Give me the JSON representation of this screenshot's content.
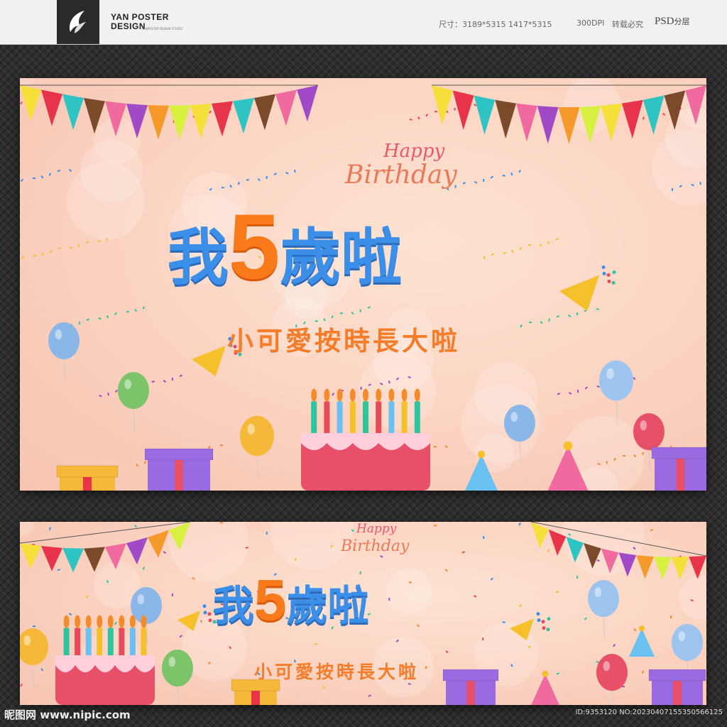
{
  "header": {
    "brand_line1": "YAN POSTER",
    "brand_line2": "DESIGN",
    "brand_sub": "YANPOSTER DESIGN STUDIO",
    "size_label": "尺寸：3189*5315  1417*5315",
    "dpi": "300DPI",
    "copyright": "转载必究",
    "psd": "PSD",
    "layers": "分层"
  },
  "poster": {
    "happy": "Happy",
    "birthday": "Birthday",
    "title_char1": "我",
    "title_number": "5",
    "title_rest": "歲啦",
    "subtitle": "小可愛按時長大啦"
  },
  "watermark": {
    "site": "昵图网 www.nipic.com",
    "id": "ID:9353120 NO:20230407155350566125"
  },
  "colors": {
    "title_blue": "#3b8fe8",
    "number_orange": "#f97a1a",
    "subtitle_orange": "#f57d2a",
    "background_peach": "#fbd2c0"
  }
}
